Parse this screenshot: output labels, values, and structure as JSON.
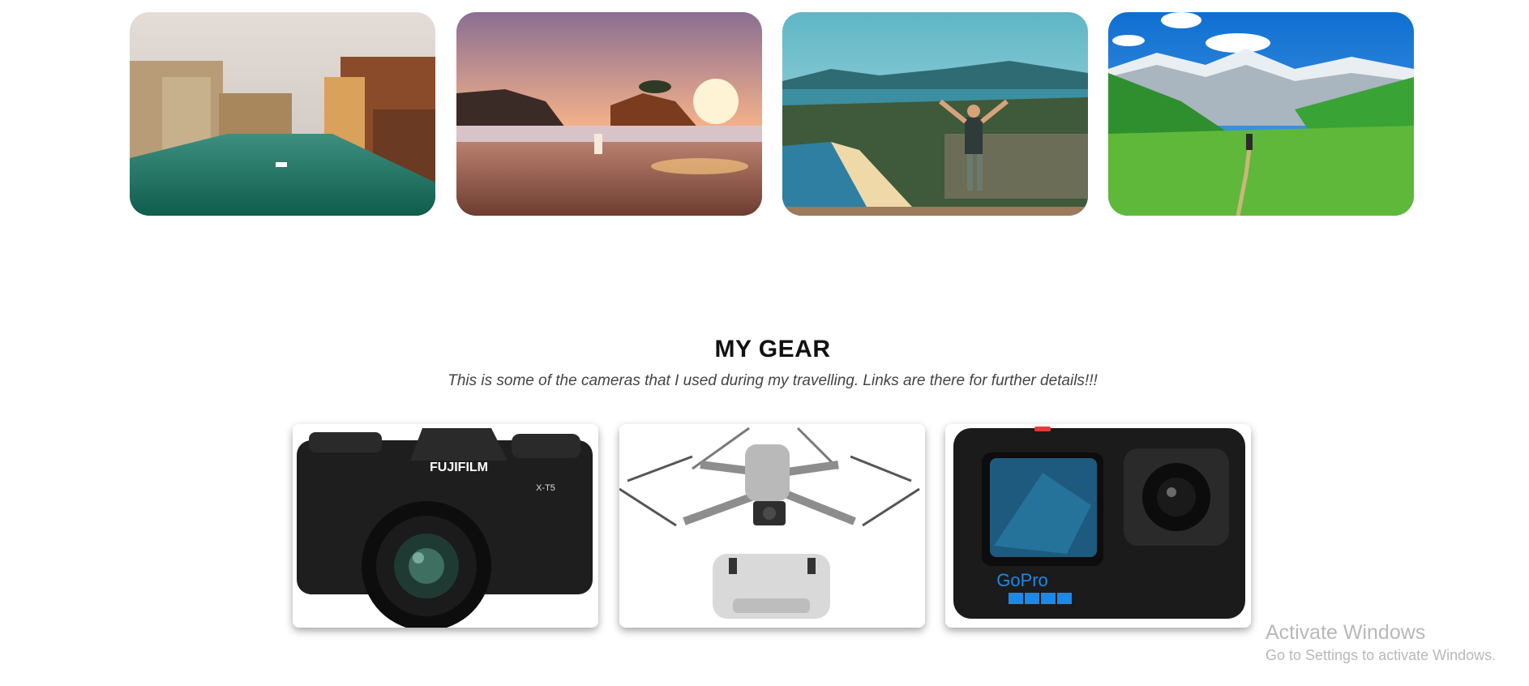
{
  "destinations": [
    {
      "icon": "venice-canal-photo"
    },
    {
      "icon": "beach-sunset-photo"
    },
    {
      "icon": "coastal-hiker-photo"
    },
    {
      "icon": "mountain-valley-photo"
    }
  ],
  "gear_section": {
    "title": "MY GEAR",
    "subtitle": "This is some of the cameras that I used during my travelling. Links are there for further details!!!",
    "items": [
      {
        "icon": "fujifilm-camera-photo",
        "brand_text": "FUJIFILM",
        "model_text": "X-T5"
      },
      {
        "icon": "dji-drone-photo"
      },
      {
        "icon": "gopro-camera-photo",
        "brand_text": "GoPro"
      }
    ]
  },
  "watermark": {
    "line1": "Activate Windows",
    "line2": "Go to Settings to activate Windows."
  }
}
